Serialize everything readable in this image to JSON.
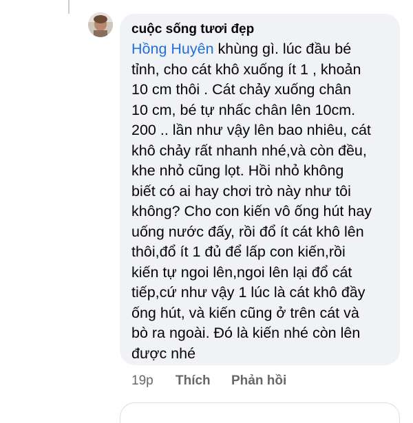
{
  "comment": {
    "author": "cuộc sống tươi đẹp",
    "mention": "Hồng Huyên",
    "text_first_line": " khùng gì. lúc đầu bé",
    "text_rest": "tỉnh, cho cát khô xuống ít 1 , khoản\n10 cm thôi . Cát chảy xuống chân\n10 cm, bé tự nhấc chân lên 10cm.\n200 .. lần như vậy lên bao nhiêu, cát\nkhô chảy rất nhanh nhé,và còn đều,\nkhe nhỏ cũng lọt. Hồi nhỏ không\nbiết có ai hay chơi trò này như tôi\nkhông? Cho con kiến vô ống hút hay\nuống nước đấy, rồi đổ ít cát khô lên\nthôi,đổ ít 1 đủ để lấp con kiến,rồi\nkiến tự ngoi lên,ngoi lên lại đổ cát\ntiếp,cứ như vậy 1 lúc là cát khô đầy\nống hút, và kiến cũng ở trên cát và\nbò ra ngoài. Đó là kiến nhé còn lên\nđược nhé"
  },
  "actions": {
    "time": "19p",
    "like": "Thích",
    "reply": "Phản hồi"
  },
  "colors": {
    "bubble": "#f0f2f5",
    "mention": "#216fdb",
    "meta": "#65676b"
  }
}
